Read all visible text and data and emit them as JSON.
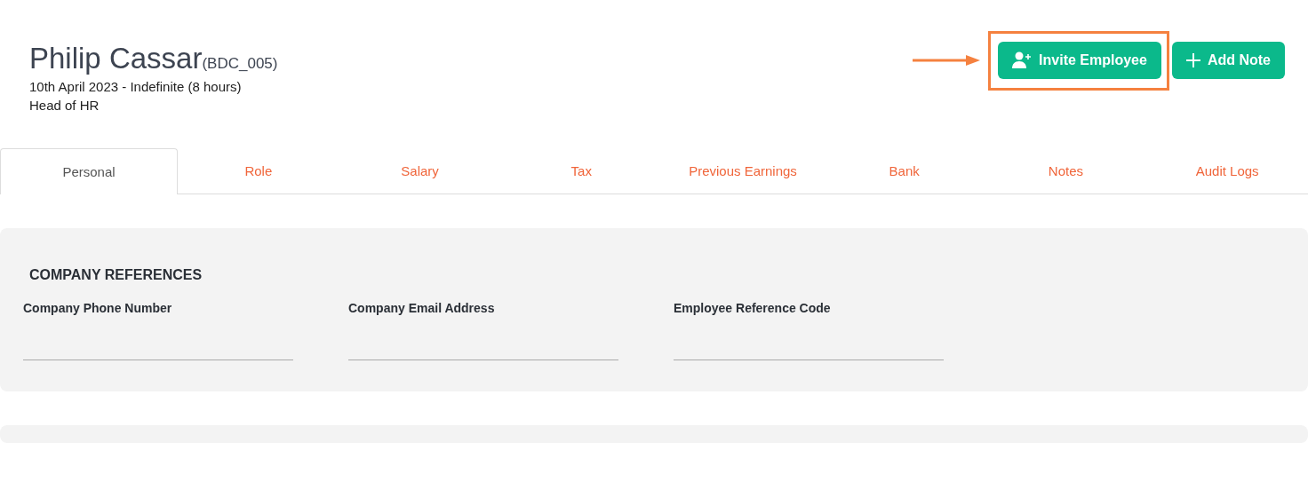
{
  "employee": {
    "name": "Philip Cassar",
    "code": "(BDC_005)",
    "period": "10th April 2023 - Indefinite (8 hours)",
    "role": "Head of HR"
  },
  "actions": [
    {
      "kind": "invite",
      "label": "Invite Employee",
      "highlighted": true
    },
    {
      "kind": "add",
      "label": "Add Note",
      "highlighted": false
    }
  ],
  "tabs": [
    {
      "label": "Personal",
      "selected": true
    },
    {
      "label": "Role",
      "selected": false
    },
    {
      "label": "Salary",
      "selected": false
    },
    {
      "label": "Tax",
      "selected": false
    },
    {
      "label": "Previous Earnings",
      "selected": false
    },
    {
      "label": "Bank",
      "selected": false
    },
    {
      "label": "Notes",
      "selected": false
    },
    {
      "label": "Audit Logs",
      "selected": false
    }
  ],
  "section": {
    "title": "COMPANY REFERENCES",
    "fields": [
      {
        "label": "Company Phone Number"
      },
      {
        "label": "Company Email Address"
      },
      {
        "label": "Employee Reference Code"
      }
    ]
  }
}
